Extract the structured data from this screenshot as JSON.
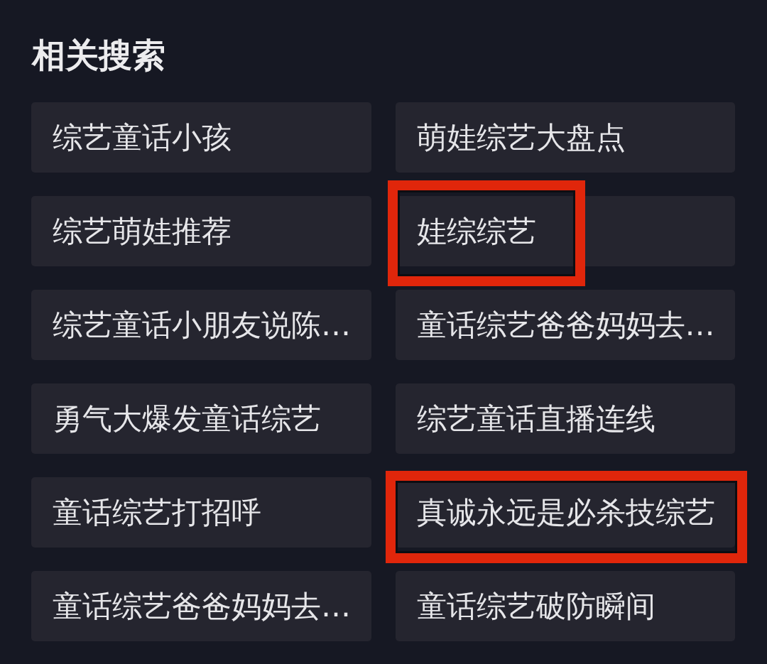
{
  "section": {
    "title": "相关搜索"
  },
  "items": [
    {
      "label": "综艺童话小孩",
      "kind": "plain"
    },
    {
      "label": "萌娃综艺大盘点",
      "kind": "plain"
    },
    {
      "label": "综艺萌娃推荐",
      "kind": "plain"
    },
    {
      "label": "娃综综艺",
      "kind": "text_framed"
    },
    {
      "label": "综艺童话小朋友说陈…",
      "kind": "plain"
    },
    {
      "label": "童话综艺爸爸妈妈去…",
      "kind": "plain"
    },
    {
      "label": "勇气大爆发童话综艺",
      "kind": "plain"
    },
    {
      "label": "综艺童话直播连线",
      "kind": "plain"
    },
    {
      "label": "童话综艺打招呼",
      "kind": "plain"
    },
    {
      "label": "真诚永远是必杀技综艺",
      "kind": "tile_framed"
    },
    {
      "label": "童话综艺爸爸妈妈去…",
      "kind": "plain"
    },
    {
      "label": "童话综艺破防瞬间",
      "kind": "plain"
    }
  ]
}
